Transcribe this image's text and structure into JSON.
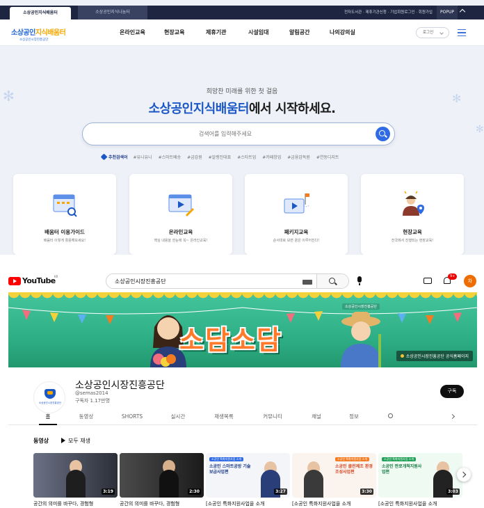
{
  "site": {
    "tabs": [
      "소상공인지식배움터",
      "소상공인지식나눔터"
    ],
    "util_links": "전자도서관 · 제휴기관신청 · 기업회원로그인 · 회원가입",
    "popup": "POPUP",
    "logo": {
      "main_a": "소상공인",
      "main_b": "지식배움터",
      "sub": "소상공인시장진흥공단"
    },
    "menu": [
      "온라인교육",
      "현장교육",
      "제휴기관",
      "시설임대",
      "알림공간",
      "나의강의실"
    ],
    "login": "로그인",
    "hero_sub": "희망찬 미래를 위한 첫 걸음",
    "hero_title_a": "소상공인지식배움터",
    "hero_title_b": "에서 시작하세요.",
    "search_placeholder": "검색어를 입력해주세요",
    "keywords_label": "추천검색어",
    "keywords": [
      "#유니유니",
      "#스마트배송",
      "#금감원",
      "#알렝진대표",
      "#스타트업",
      "#카페창업",
      "#금융감독원",
      "#연동디지트"
    ],
    "cards": [
      {
        "title": "배움터 이용가이드",
        "desc": "배움터 이렇게 활용해보세요!",
        "icon": "guide-icon"
      },
      {
        "title": "온라인교육",
        "desc": "핵심 내용을 한눈에 쏙~ 온라인교육!",
        "icon": "online-edu-icon"
      },
      {
        "title": "패키지교육",
        "desc": "순서대로 보면 꿈은 이루어진다!",
        "icon": "package-icon"
      },
      {
        "title": "현장교육",
        "desc": "전국에서 진행되는 현장교육!",
        "icon": "onsite-icon"
      }
    ]
  },
  "youtube": {
    "logo": "YouTube",
    "logo_region": "KR",
    "search_value": "소상공인시장진흥공단",
    "notif_badge": "9+",
    "avatar_letter": "차",
    "banner_title": "소담소담",
    "banner_brand": "소상공인시장진흥공단",
    "banner_link": "소상공인시장진흥공단 공식홈페이지",
    "channel_logo_text": "소상공인시장진흥공단",
    "channel_name": "소상공인시장진흥공단",
    "handle": "@semas2014",
    "subscribers": "구독자 1.17만명",
    "subscribe": "구독",
    "tabs": [
      "홈",
      "동영상",
      "SHORTS",
      "실시간",
      "재생목록",
      "커뮤니티",
      "채널",
      "정보"
    ],
    "section_title": "동영상",
    "play_all": "모두 재생",
    "videos": [
      {
        "duration": "3:19",
        "title": "공간의 의미를 바꾸다, 경험형"
      },
      {
        "duration": "2:30",
        "title": "공간의 의미를 바꾸다, 경험형"
      },
      {
        "duration": "3:27",
        "title": "[소공인 특화지원사업을 소개",
        "band": "소공인 특화지원사업 소개",
        "text": "소공인 스마트공방 기술보급사업편"
      },
      {
        "duration": "3:30",
        "title": "[소공인 특화지원사업을 소개",
        "band": "소공인 특화지원사업 소개",
        "text": "소공인 클린제조 환경조성사업편"
      },
      {
        "duration": "3:03",
        "title": "[소공인 특화지원사업을 소개",
        "band": "소공인 특화지원사업 소개",
        "text": "소공인 판로개척지원사업편"
      }
    ]
  },
  "colors": {
    "brand_blue": "#1b57c5",
    "brand_yellow": "#f4a700",
    "yt_red": "#ff0000",
    "banner_green": "#2eaf86",
    "banner_orange": "#ff7a2a"
  }
}
